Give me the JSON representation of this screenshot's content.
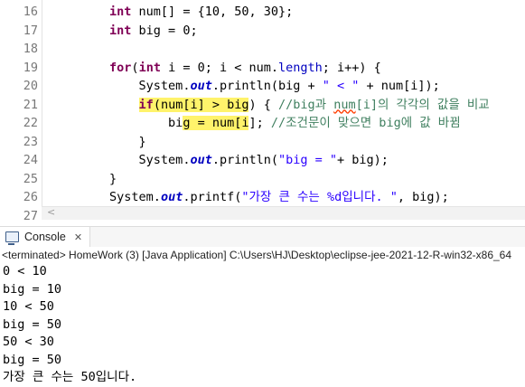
{
  "editor": {
    "line_numbers": [
      "16",
      "17",
      "18",
      "19",
      "20",
      "21",
      "22",
      "23",
      "24",
      "25",
      "26",
      "27"
    ],
    "lines": {
      "l16": {
        "indent": "        ",
        "kw": "int",
        "rest": " num[] = {10, 50, 30};"
      },
      "l17": {
        "indent": "        ",
        "kw": "int",
        "rest": " big = 0;"
      },
      "l19": {
        "indent": "        ",
        "kw1": "for",
        "p1": "(",
        "kw2": "int",
        "rest": " i = 0; i < num.",
        "field": "length",
        "rest2": "; i++) {"
      },
      "l20": {
        "indent": "            ",
        "a": "System.",
        "out": "out",
        "b": ".println(big + ",
        "str": "\" < \"",
        "c": " + num[i]);"
      },
      "l21": {
        "indent": "            ",
        "kw": "if",
        "hl": "(num[i] > big",
        "c": ") { ",
        "cm1": "//big과 ",
        "sq": "num",
        "cm2": "[i]의 각각의 값을 비교"
      },
      "l22": {
        "indent": "                ",
        "a": "bi",
        "hl": "g = num[i",
        "c": "]; ",
        "cm": "//조건문이 맞으면 big에 값 바뀜"
      },
      "l23": {
        "text": "            }"
      },
      "l24": {
        "indent": "            ",
        "a": "System.",
        "out": "out",
        "b": ".println(",
        "str": "\"big = \"",
        "c": "+ big);"
      },
      "l25": {
        "text": "        }"
      },
      "l26": {
        "indent": "        ",
        "a": "System.",
        "out": "out",
        "b": ".printf(",
        "str": "\"가장 큰 수는 %d입니다. \"",
        "c": ", big);"
      }
    },
    "scroll_left": "<"
  },
  "console": {
    "tab_label": "Console",
    "close": "✕",
    "status": "<terminated> HomeWork (3) [Java Application] C:\\Users\\HJ\\Desktop\\eclipse-jee-2021-12-R-win32-x86_64",
    "output": [
      "0 < 10",
      "big = 10",
      "10 < 50",
      "big = 50",
      "50 < 30",
      "big = 50",
      "가장 큰 수는 50입니다."
    ]
  },
  "colors": {
    "keyword": "#7f0055",
    "string": "#2a00ff",
    "comment": "#3f7f5f",
    "field": "#0000c0",
    "highlight": "#fff36b"
  },
  "icons": {
    "console_tab": "console-monitor-icon",
    "close": "close-icon"
  }
}
